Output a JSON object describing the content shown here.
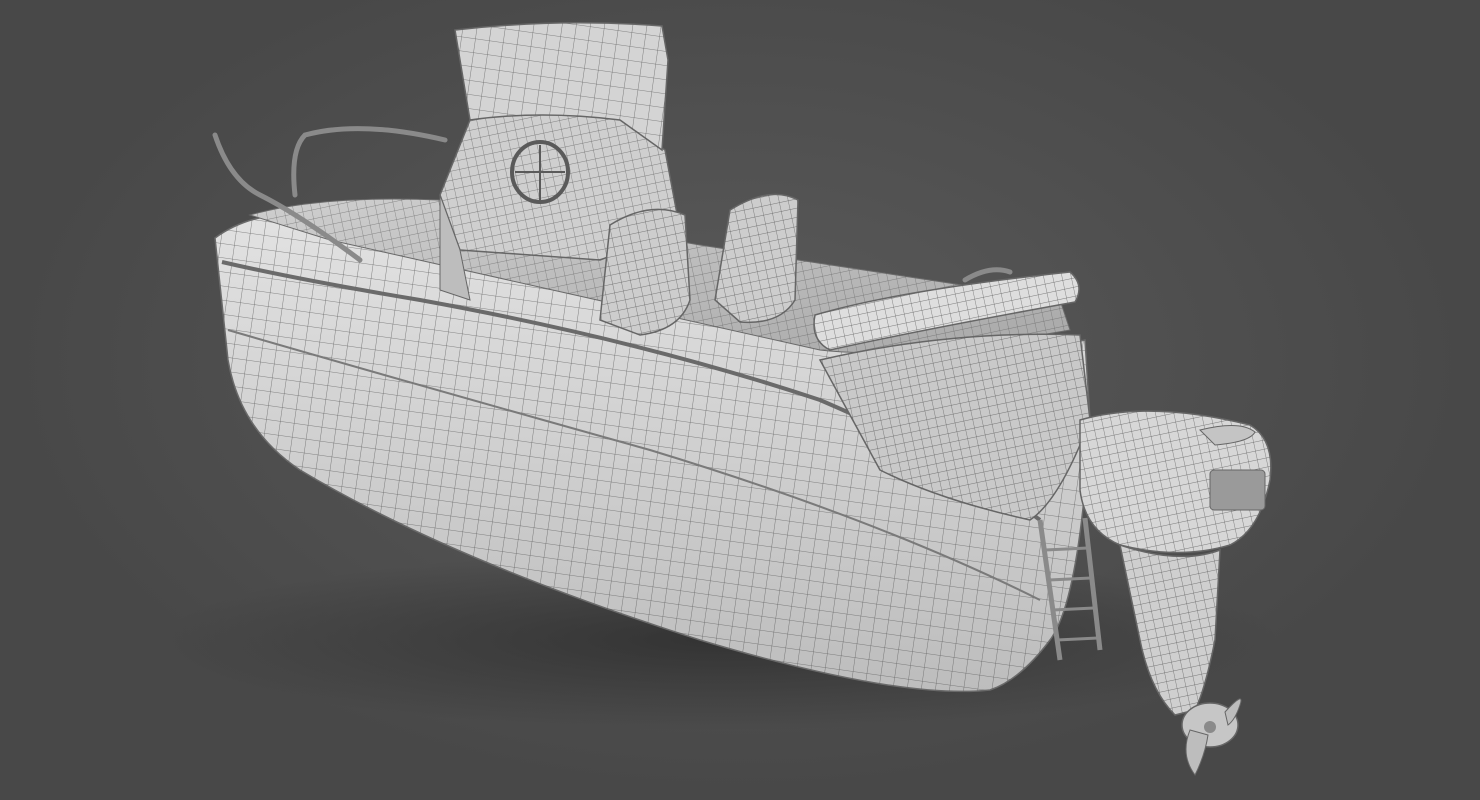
{
  "scene": {
    "subject": "center-console-boat-wireframe-render",
    "colors": {
      "background": "#484848",
      "background_center": "#5a5a5a",
      "hull": "#d9d9d9",
      "hull_shadow": "#9a9a9a",
      "mesh_line": "#5c5c5c",
      "ground_shadow": "#2e2e2e"
    },
    "parts": [
      "hull",
      "deck-rail",
      "console",
      "windshield",
      "steering-wheel",
      "helm-seat-left",
      "helm-seat-right",
      "stern-cushion",
      "swim-ladder",
      "outboard-motor",
      "propeller"
    ]
  }
}
